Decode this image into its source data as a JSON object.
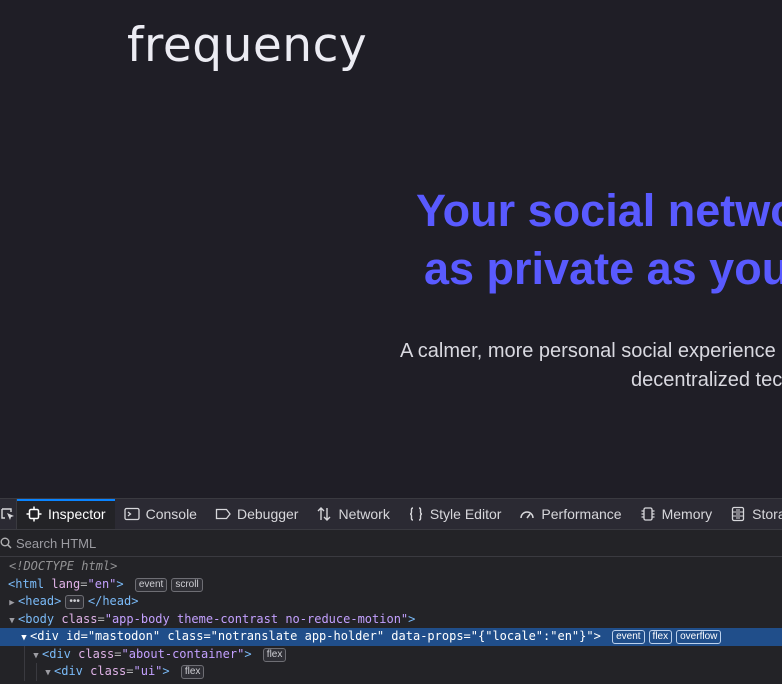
{
  "page": {
    "logo": "frequency",
    "hero_title_line1": "Your social netwo",
    "hero_title_line2": "as private as you",
    "hero_sub_line1": "A calmer, more personal social experience b",
    "hero_sub_line2": "decentralized tec"
  },
  "devtools": {
    "tabs": [
      {
        "label": "Inspector",
        "icon": "inspector-icon"
      },
      {
        "label": "Console",
        "icon": "console-icon"
      },
      {
        "label": "Debugger",
        "icon": "debugger-icon"
      },
      {
        "label": "Network",
        "icon": "network-icon"
      },
      {
        "label": "Style Editor",
        "icon": "style-editor-icon"
      },
      {
        "label": "Performance",
        "icon": "performance-icon"
      },
      {
        "label": "Memory",
        "icon": "memory-icon"
      },
      {
        "label": "Storag",
        "icon": "storage-icon"
      }
    ],
    "search_placeholder": "Search HTML",
    "tree": {
      "doctype": "<!DOCTYPE html>",
      "html_tag": "<html",
      "html_attr": "lang",
      "html_val": "\"en\"",
      "html_end": ">",
      "html_badges": [
        "event",
        "scroll"
      ],
      "head_open": "<head>",
      "head_close": "</head>",
      "body_tag": "<body",
      "body_attr": "class",
      "body_val": "\"app-body theme-contrast no-reduce-motion\"",
      "body_end": ">",
      "div1_tag": "<div",
      "div1_attr1": "id",
      "div1_val1": "\"mastodon\"",
      "div1_attr2": "class",
      "div1_val2": "\"notranslate app-holder\"",
      "div1_attr3": "data-props",
      "div1_val3": "\"{\"locale\":\"en\"}\"",
      "div1_end": ">",
      "div1_badges": [
        "event",
        "flex",
        "overflow"
      ],
      "div2_tag": "<div",
      "div2_attr": "class",
      "div2_val": "\"about-container\"",
      "div2_end": ">",
      "div2_badges": [
        "flex"
      ],
      "div3_tag": "<div",
      "div3_attr": "class",
      "div3_val": "\"ui\"",
      "div3_end": ">",
      "div3_badges": [
        "flex"
      ]
    }
  },
  "colors": {
    "page_bg": "#1f1e26",
    "accent": "#595aff",
    "devtools_bg": "#232327",
    "selection": "#204e8a",
    "tab_indicator": "#0a84ff"
  }
}
